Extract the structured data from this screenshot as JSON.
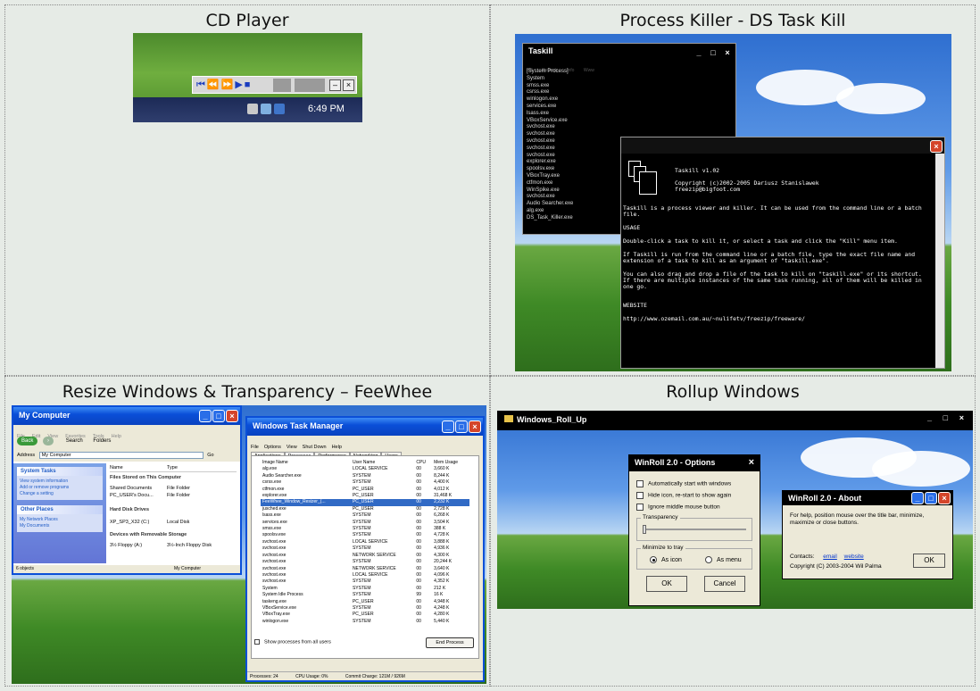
{
  "cells": [
    {
      "title": "CD Player"
    },
    {
      "title": "Process Killer - DS Task Kill"
    },
    {
      "title": "Resize Windows & Transparency – FeeWhee"
    },
    {
      "title": "Rollup Windows"
    }
  ],
  "cd_player": {
    "clock": "6:49 PM",
    "controls": [
      "⏮",
      "⏪",
      "⏩",
      "▶",
      "■"
    ],
    "minimize": "–",
    "close": "×"
  },
  "taskill": {
    "title": "Taskill",
    "menu": [
      "Kill",
      "Refresh",
      "Info",
      "Www"
    ],
    "processes": [
      "[System Process]",
      "System",
      "smss.exe",
      "csrss.exe",
      "winlogon.exe",
      "services.exe",
      "lsass.exe",
      "VBoxService.exe",
      "svchost.exe",
      "svchost.exe",
      "svchost.exe",
      "svchost.exe",
      "svchost.exe",
      "explorer.exe",
      "spoolsv.exe",
      "VBoxTray.exe",
      "ctfmon.exe",
      "WinSpike.exe",
      "svchost.exe",
      "Audio Searcher.exe",
      "alg.exe",
      "DS_Task_Killer.exe"
    ],
    "info_heading": "Taskill v1.02",
    "info_copyright": "Copyright (c)2002-2005 Dariusz Stanislawek",
    "info_email": "freezip@bigfoot.com",
    "info_p1": "Taskill is a process viewer and killer. It can be used from the command line or a batch file.",
    "usage_heading": "USAGE",
    "usage_p1": "Double-click a task to kill it, or select a task and click the \"Kill\" menu item.",
    "usage_p2": "If Taskill is run from the command line or a batch file, type the exact file name and extension of a task to kill as an argument of \"taskill.exe\".",
    "usage_p3": "You can also drag and drop a file of the task to kill on \"taskill.exe\" or its shortcut. If there are multiple instances of the same task running, all of them will be killed in one go.",
    "website_heading": "WEBSITE",
    "website_url": "http://www.ozemail.com.au/~nulifetv/freezip/freeware/"
  },
  "my_computer": {
    "title": "My Computer",
    "menu": [
      "File",
      "Edit",
      "View",
      "Favorites",
      "Tools",
      "Help"
    ],
    "back": "Back",
    "search": "Search",
    "folders": "Folders",
    "address_label": "Address",
    "address_value": "My Computer",
    "go": "Go",
    "system_tasks": "System Tasks",
    "tasks": [
      "View system information",
      "Add or remove programs",
      "Change a setting"
    ],
    "other_places": "Other Places",
    "places": [
      "My Network Places",
      "My Documents"
    ],
    "col_name": "Name",
    "col_type": "Type",
    "section1": "Files Stored on This Computer",
    "files": [
      {
        "name": "Shared Documents",
        "type": "File Folder"
      },
      {
        "name": "PC_USER's Docu...",
        "type": "File Folder"
      }
    ],
    "section2": "Hard Disk Drives",
    "disk": {
      "name": "XP_SP3_X32 (C:)",
      "type": "Local Disk"
    },
    "section3": "Devices with Removable Storage",
    "floppy": {
      "name": "3½ Floppy (A:)",
      "type": "3½-Inch Floppy Disk"
    },
    "status_left": "6 objects",
    "status_right": "My Computer"
  },
  "task_manager": {
    "title": "Windows Task Manager",
    "menu": [
      "File",
      "Options",
      "View",
      "Shut Down",
      "Help"
    ],
    "tabs": [
      "Applications",
      "Processes",
      "Performance",
      "Networking",
      "Users"
    ],
    "columns": [
      "Image Name",
      "User Name",
      "CPU",
      "Mem Usage"
    ],
    "rows": [
      [
        "alg.exe",
        "LOCAL SERVICE",
        "00",
        "3,660 K"
      ],
      [
        "Audio Searcher.exe",
        "SYSTEM",
        "00",
        "8,244 K"
      ],
      [
        "csrss.exe",
        "SYSTEM",
        "00",
        "4,400 K"
      ],
      [
        "ctfmon.exe",
        "PC_USER",
        "00",
        "4,012 K"
      ],
      [
        "explorer.exe",
        "PC_USER",
        "00",
        "31,468 K"
      ],
      [
        "FeeWhee_Window_Resizer_(...",
        "PC_USER",
        "00",
        "2,232 K"
      ],
      [
        "jusched.exe",
        "PC_USER",
        "00",
        "2,728 K"
      ],
      [
        "lsass.exe",
        "SYSTEM",
        "00",
        "6,268 K"
      ],
      [
        "services.exe",
        "SYSTEM",
        "00",
        "3,504 K"
      ],
      [
        "smss.exe",
        "SYSTEM",
        "00",
        "388 K"
      ],
      [
        "spoolsv.exe",
        "SYSTEM",
        "00",
        "4,728 K"
      ],
      [
        "svchost.exe",
        "LOCAL SERVICE",
        "00",
        "3,888 K"
      ],
      [
        "svchost.exe",
        "SYSTEM",
        "00",
        "4,936 K"
      ],
      [
        "svchost.exe",
        "NETWORK SERVICE",
        "00",
        "4,300 K"
      ],
      [
        "svchost.exe",
        "SYSTEM",
        "00",
        "20,244 K"
      ],
      [
        "svchost.exe",
        "NETWORK SERVICE",
        "00",
        "3,640 K"
      ],
      [
        "svchost.exe",
        "LOCAL SERVICE",
        "00",
        "4,096 K"
      ],
      [
        "svchost.exe",
        "SYSTEM",
        "00",
        "4,352 K"
      ],
      [
        "System",
        "SYSTEM",
        "00",
        "212 K"
      ],
      [
        "System Idle Process",
        "SYSTEM",
        "99",
        "16 K"
      ],
      [
        "taskeng.exe",
        "PC_USER",
        "00",
        "4,948 K"
      ],
      [
        "VBoxService.exe",
        "SYSTEM",
        "00",
        "4,248 K"
      ],
      [
        "VBoxTray.exe",
        "PC_USER",
        "00",
        "4,280 K"
      ],
      [
        "winlogon.exe",
        "SYSTEM",
        "00",
        "5,440 K"
      ]
    ],
    "selected_row": 5,
    "show_all": "Show processes from all users",
    "end_process": "End Process",
    "status": [
      "Processes: 24",
      "CPU Usage: 0%",
      "Commit Charge: 121M / 926M"
    ]
  },
  "rollup": {
    "title": "Windows_Roll_Up",
    "options_title": "WinRoll 2.0 - Options",
    "options": [
      "Automatically start with windows",
      "Hide icon, re-start to show again",
      "Ignore middle mouse button"
    ],
    "transparency": "Transparency",
    "minimize_to_tray": "Minimize to tray",
    "as_icon": "As icon",
    "as_menu": "As menu",
    "ok": "OK",
    "cancel": "Cancel",
    "about_title": "WinRoll 2.0 - About",
    "about_text": "For help, position mouse over the title bar, minimize, maximize or close buttons.",
    "contacts_label": "Contacts:",
    "email": "email",
    "website": "website",
    "copyright": "Copyright (C) 2003-2004 Wil Palma",
    "about_ok": "OK"
  }
}
